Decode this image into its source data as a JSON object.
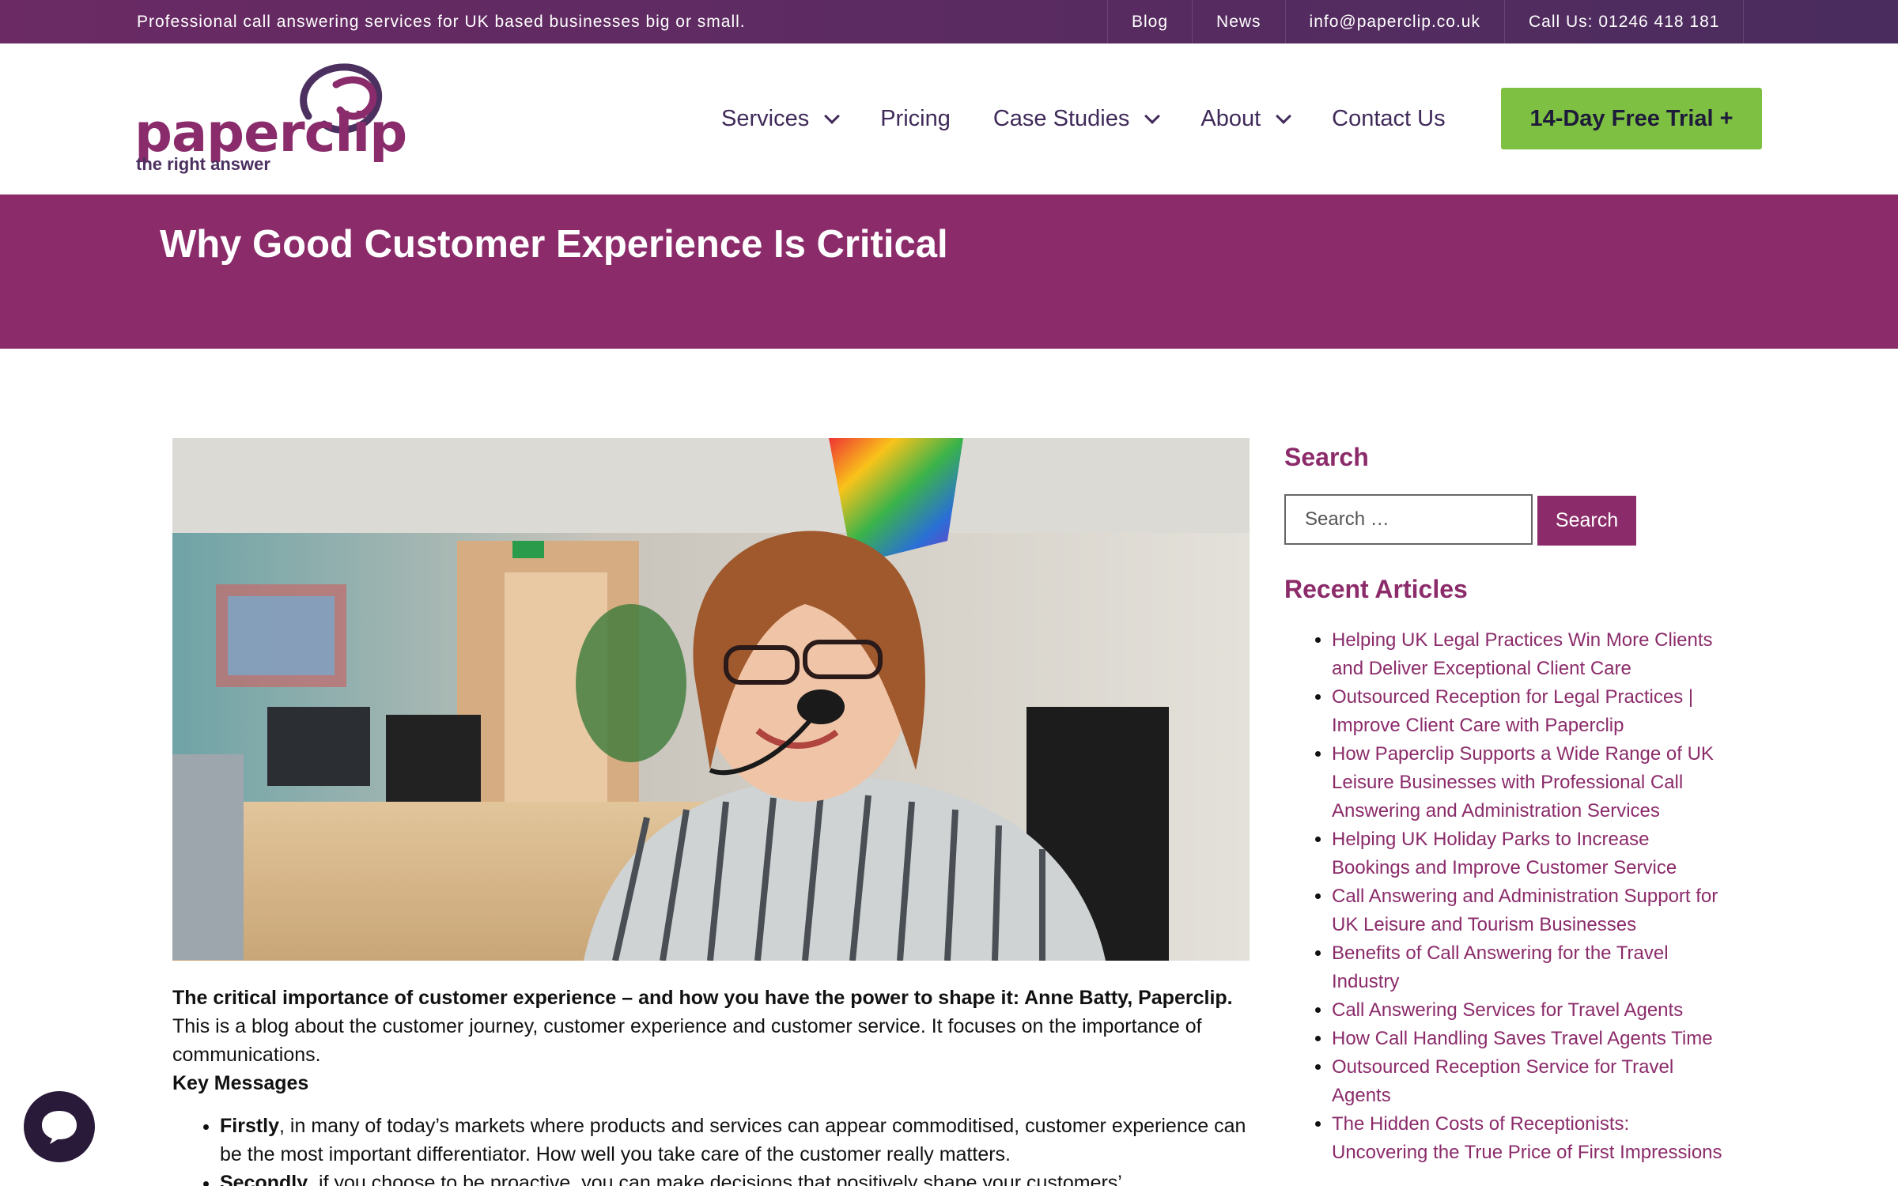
{
  "topbar": {
    "tagline": "Professional call answering services for UK based businesses big or small.",
    "links": [
      "Blog",
      "News",
      "info@paperclip.co.uk",
      "Call Us: 01246 418 181"
    ]
  },
  "logo": {
    "word": "paperclip",
    "tagline": "the right answer"
  },
  "nav": {
    "services": "Services",
    "pricing": "Pricing",
    "case_studies": "Case Studies",
    "about": "About",
    "contact": "Contact Us",
    "trial": "14-Day Free Trial +"
  },
  "page": {
    "title": "Why Good Customer Experience Is Critical"
  },
  "article": {
    "lead": "The critical importance of customer experience – and how you have the power to shape it: Anne Batty, Paperclip.",
    "intro": "This is a blog about the customer journey, customer experience and customer service. It focuses on the importance of communications.",
    "key_messages": "Key Messages",
    "bullets": [
      {
        "bold": "Firstly",
        "text": ", in many of today’s markets where products and services can appear commoditised, customer experience can be the most important differentiator. How well you take care of the customer really matters."
      },
      {
        "bold": "Secondly",
        "text": ", if you choose to be proactive, you can make decisions that positively shape your customers’"
      }
    ]
  },
  "sidebar": {
    "search_title": "Search",
    "search_placeholder": "Search …",
    "search_button": "Search",
    "recent_title": "Recent Articles",
    "recent": [
      "Helping UK Legal Practices Win More Clients and Deliver Exceptional Client Care",
      "Outsourced Reception for Legal Practices | Improve Client Care with Paperclip",
      "How Paperclip Supports a Wide Range of UK Leisure Businesses with Professional Call Answering and Administration Services",
      "Helping UK Holiday Parks to Increase Bookings and Improve Customer Service",
      "Call Answering and Administration Support for UK Leisure and Tourism Businesses",
      "Benefits of Call Answering for the Travel Industry",
      "Call Answering Services for Travel Agents",
      "How Call Handling Saves Travel Agents Time",
      "Outsourced Reception Service for Travel Agents",
      "The Hidden Costs of Receptionists: Uncovering the True Price of First Impressions"
    ]
  },
  "colors": {
    "brand_purple": "#8b2b6a",
    "nav_text": "#3f2a59",
    "trial_green": "#7dc042"
  }
}
